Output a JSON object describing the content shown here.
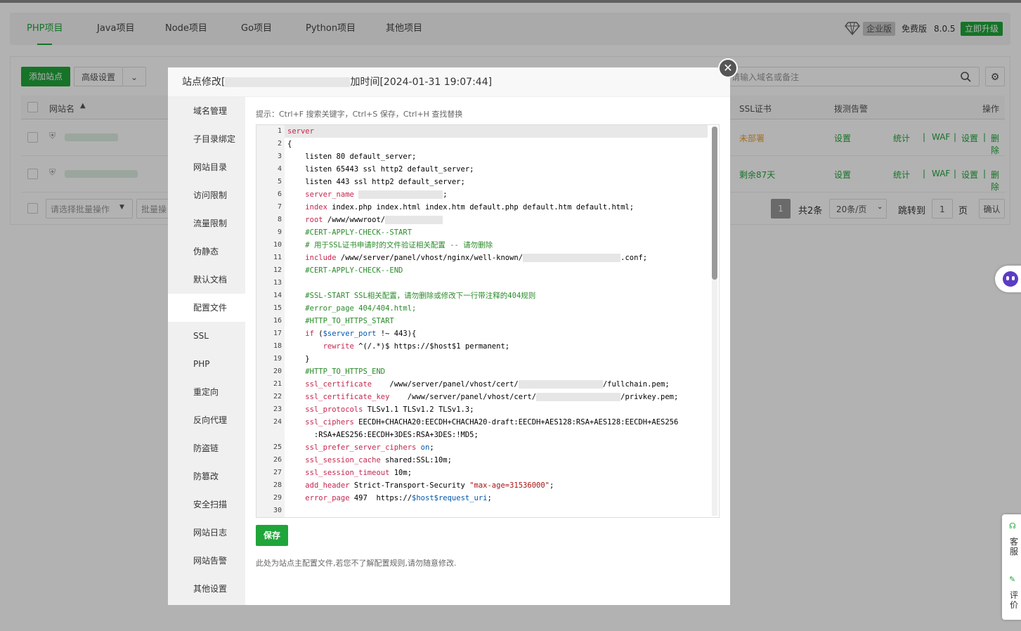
{
  "tabs": [
    "PHP项目",
    "Java项目",
    "Node项目",
    "Go项目",
    "Python项目",
    "其他项目"
  ],
  "version": {
    "enterprise": "企业版",
    "free": "免费版",
    "number": "8.0.5",
    "upgrade": "立即升级"
  },
  "toolbar": {
    "add_site": "添加站点",
    "advanced": "高级设置",
    "search_placeholder": "请输入域名或备注"
  },
  "table": {
    "headers": {
      "site": "网站名",
      "ssl": "SSL证书",
      "probe": "拨测告警",
      "ops": "操作"
    },
    "rows": [
      {
        "ssl": "未部署",
        "probe": "设置",
        "ops": [
          "统计",
          "WAF",
          "设置",
          "删除"
        ]
      },
      {
        "ssl": "剩余87天",
        "probe": "设置",
        "ops": [
          "统计",
          "WAF",
          "设置",
          "删除"
        ]
      }
    ]
  },
  "footer": {
    "batch_placeholder": "请选择批量操作",
    "batch_btn": "批量操",
    "page": "1",
    "total": "共2条",
    "per_page": "20条/页",
    "jump": "跳转到",
    "jump_val": "1",
    "page_unit": "页",
    "confirm": "确认"
  },
  "modal": {
    "title_prefix": "站点修改[",
    "title_suffix": "加时间[2024-01-31 19:07:44]",
    "menu": [
      "域名管理",
      "子目录绑定",
      "网站目录",
      "访问限制",
      "流量限制",
      "伪静态",
      "默认文档",
      "配置文件",
      "SSL",
      "PHP",
      "重定向",
      "反向代理",
      "防盗链",
      "防篡改",
      "安全扫描",
      "网站日志",
      "网站告警",
      "其他设置"
    ],
    "active_menu": "配置文件",
    "hint": "提示：Ctrl+F 搜索关键字，Ctrl+S 保存，Ctrl+H 查找替换",
    "save": "保存",
    "note": "此处为站点主配置文件,若您不了解配置规则,请勿随意修改."
  },
  "side_float": {
    "service": "客服",
    "review": "评价"
  },
  "colors": {
    "accent": "#20a53a",
    "warn": "#e6a23c"
  }
}
